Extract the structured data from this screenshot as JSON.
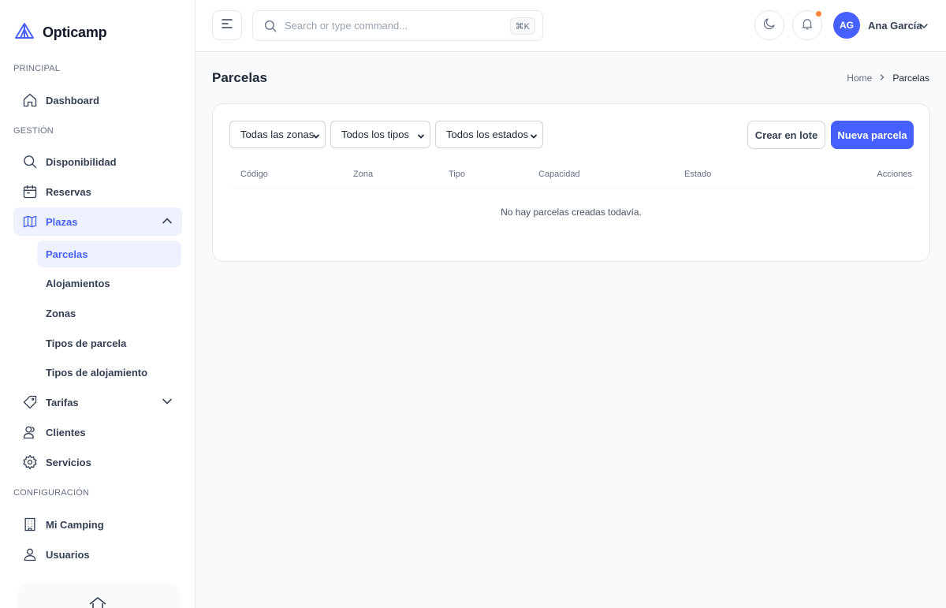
{
  "app": {
    "name": "Opticamp",
    "accent": "#465fff"
  },
  "sidebar": {
    "sections": {
      "principal": "PRINCIPAL",
      "gestion": "GESTIÓN",
      "configuracion": "CONFIGURACIÓN"
    },
    "items": {
      "dashboard": {
        "label": "Dashboard",
        "icon": "home-icon"
      },
      "disponibilidad": {
        "label": "Disponibilidad",
        "icon": "search-icon"
      },
      "reservas": {
        "label": "Reservas",
        "icon": "calendar-icon"
      },
      "plazas": {
        "label": "Plazas",
        "icon": "map-icon",
        "expanded": true
      },
      "tarifas": {
        "label": "Tarifas",
        "icon": "tag-icon",
        "expanded": false
      },
      "clientes": {
        "label": "Clientes",
        "icon": "users-icon"
      },
      "servicios": {
        "label": "Servicios",
        "icon": "gear-icon"
      },
      "mi_camping": {
        "label": "Mi Camping",
        "icon": "building-icon"
      },
      "usuarios": {
        "label": "Usuarios",
        "icon": "user-icon"
      }
    },
    "plazas_sub": [
      {
        "label": "Parcelas",
        "active": true
      },
      {
        "label": "Alojamientos"
      },
      {
        "label": "Zonas"
      },
      {
        "label": "Tipos de parcela"
      },
      {
        "label": "Tipos de alojamiento"
      }
    ]
  },
  "header": {
    "search_placeholder": "Search or type command...",
    "shortcut": "⌘K",
    "user_initials": "AG",
    "user_name": "Ana García",
    "notification_dot_color": "#fd853a"
  },
  "page": {
    "title": "Parcelas",
    "breadcrumb": {
      "home": "Home",
      "current": "Parcelas"
    }
  },
  "filters": {
    "zonas": "Todas las zonas",
    "tipos": "Todos los tipos",
    "estados": "Todos los estados"
  },
  "actions": {
    "batch": "Crear en lote",
    "new": "Nueva parcela"
  },
  "table": {
    "columns": [
      "Código",
      "Zona",
      "Tipo",
      "Capacidad",
      "Estado",
      "Acciones"
    ],
    "rows": [],
    "empty_message": "No hay parcelas creadas todavía."
  }
}
